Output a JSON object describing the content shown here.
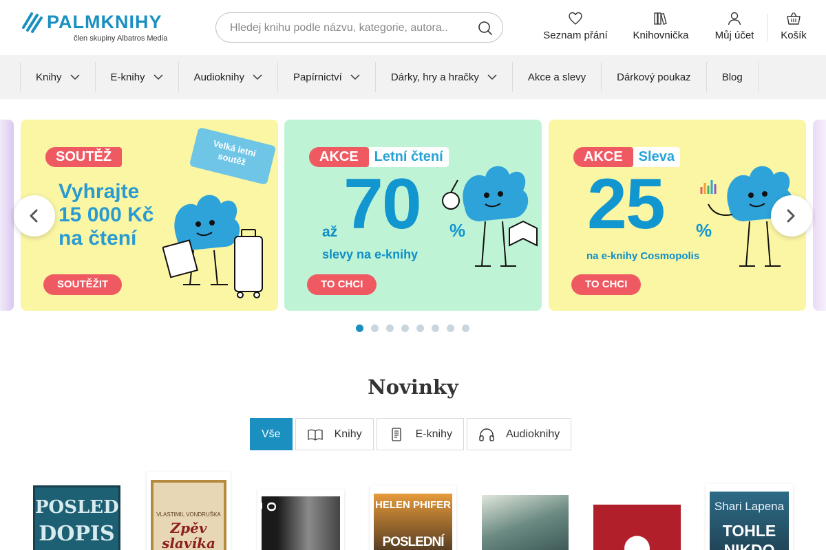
{
  "brand": {
    "name_part1": "PALM",
    "name_part2": "KNIHY",
    "subtitle": "člen skupiny Albatros Media",
    "color": "#1a8fc0"
  },
  "search": {
    "placeholder": "Hledej knihu podle názvu, kategorie, autora.."
  },
  "header_links": {
    "wishlist": "Seznam přání",
    "library": "Knihovnička",
    "account": "Můj účet",
    "cart": "Košík"
  },
  "nav": [
    {
      "label": "Knihy",
      "has_dropdown": true
    },
    {
      "label": "E-knihy",
      "has_dropdown": true
    },
    {
      "label": "Audioknihy",
      "has_dropdown": true
    },
    {
      "label": "Papírnictví",
      "has_dropdown": true
    },
    {
      "label": "Dárky, hry a hračky",
      "has_dropdown": true
    },
    {
      "label": "Akce a slevy",
      "has_dropdown": false
    },
    {
      "label": "Dárkový poukaz",
      "has_dropdown": false
    },
    {
      "label": "Blog",
      "has_dropdown": false
    }
  ],
  "banners": {
    "b1": {
      "tag": "SOUTĚŽ",
      "ticket_line1": "Velká letní",
      "ticket_line2": "soutěž",
      "line1": "Vyhrajte",
      "line2": "15 000 Kč",
      "line3": "na čtení",
      "cta": "SOUTĚŽIT"
    },
    "b2": {
      "tag": "AKCE",
      "tag_rest": "Letní čtení",
      "prefix": "až",
      "big": "70",
      "pct": "%",
      "sub": "slevy na e-knihy",
      "cta": "TO CHCI"
    },
    "b3": {
      "tag": "AKCE",
      "tag_rest": "Sleva",
      "big": "25",
      "pct": "%",
      "sub": "na e-knihy Cosmopolis",
      "cta": "TO CHCI"
    }
  },
  "carousel": {
    "slide_count": 8,
    "active_index": 0
  },
  "novinky": {
    "title": "Novinky",
    "filters": {
      "all": "Vše",
      "books": "Knihy",
      "ebooks": "E-knihy",
      "audio": "Audioknihy"
    }
  },
  "books": [
    {
      "title_line1": "POSLEDNÍ",
      "title_line2": "DOPIS",
      "cover_color": "#1d5f73"
    },
    {
      "author": "VLASTIMIL VONDRUŠKA",
      "title_line1": "Zpěv",
      "title_line2": "slavíka",
      "cover_color": "#e7d7b4"
    },
    {
      "title_line1": "O Z",
      "cover_color": "#2a2a2a"
    },
    {
      "author": "HELEN PHIFER",
      "title_line1": "POSLEDNÍ",
      "cover_color": "#d38b2a"
    },
    {
      "cover_color": "#6b8a82"
    },
    {
      "cover_color": "#b01f2a"
    },
    {
      "author": "Shari Lapena",
      "title_line1": "TOHLE",
      "title_line2": "NIKDO",
      "cover_color": "#1f3f52"
    }
  ]
}
